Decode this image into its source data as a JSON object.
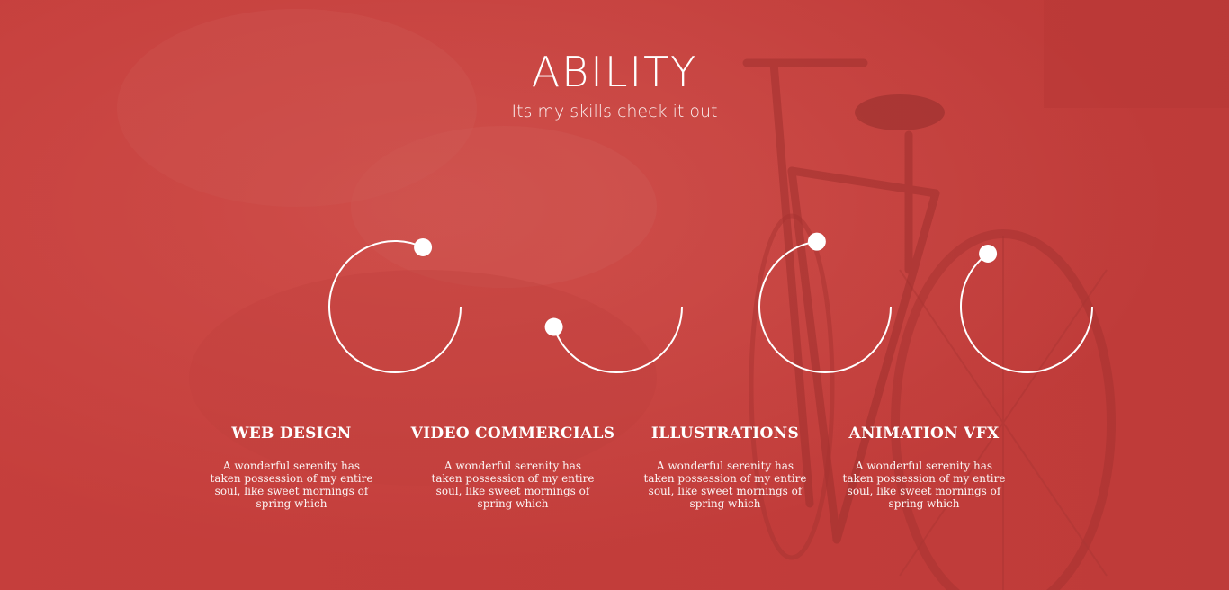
{
  "header": {
    "title": "ABILITY",
    "subtitle": "Its my skills check it out"
  },
  "skills": [
    {
      "title": "WEB DESIGN",
      "description": "A wonderful serenity has taken possession of my entire soul, like sweet mornings of spring which",
      "progress": 0.82
    },
    {
      "title": "VIDEO COMMERCIALS",
      "description": "A wonderful serenity has taken possession of my entire soul, like sweet mornings of spring which",
      "progress": 0.45
    },
    {
      "title": "ILLUSTRATIONS",
      "description": "A wonderful serenity has taken possession of my entire soul, like sweet mornings of spring which",
      "progress": 0.73
    },
    {
      "title": "ANIMATION VFX",
      "description": "A wonderful serenity has taken possession of my entire soul, like sweet mornings of spring which",
      "progress": 0.65
    }
  ],
  "colors": {
    "background": "#c8403d",
    "accent": "#ffffff"
  }
}
